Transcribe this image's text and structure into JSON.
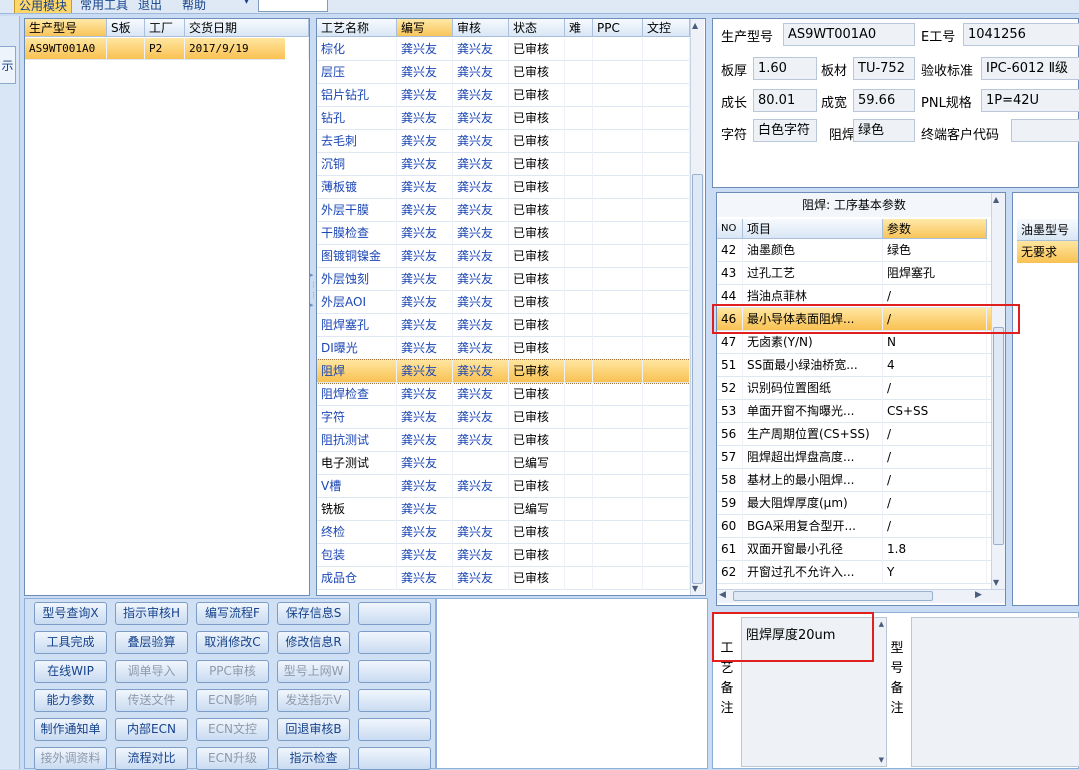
{
  "menu": {
    "items": [
      "公用模块",
      "常用工具",
      "退出",
      "帮助"
    ]
  },
  "left_tab": "示",
  "orders": {
    "headers": [
      "生产型号",
      "S板",
      "工厂",
      "交货日期"
    ],
    "rows": [
      [
        "AS9WT001A0",
        "",
        "P2",
        "2017/9/19"
      ]
    ]
  },
  "process": {
    "headers": [
      "工艺名称",
      "编写",
      "审核",
      "状态",
      "难",
      "PPC",
      "文控"
    ],
    "rows": [
      [
        "棕化",
        "龚兴友",
        "龚兴友",
        "已审核"
      ],
      [
        "层压",
        "龚兴友",
        "龚兴友",
        "已审核"
      ],
      [
        "铝片钻孔",
        "龚兴友",
        "龚兴友",
        "已审核"
      ],
      [
        "钻孔",
        "龚兴友",
        "龚兴友",
        "已审核"
      ],
      [
        "去毛刺",
        "龚兴友",
        "龚兴友",
        "已审核"
      ],
      [
        "沉铜",
        "龚兴友",
        "龚兴友",
        "已审核"
      ],
      [
        "薄板镀",
        "龚兴友",
        "龚兴友",
        "已审核"
      ],
      [
        "外层干膜",
        "龚兴友",
        "龚兴友",
        "已审核"
      ],
      [
        "干膜检查",
        "龚兴友",
        "龚兴友",
        "已审核"
      ],
      [
        "图镀铜镍金",
        "龚兴友",
        "龚兴友",
        "已审核"
      ],
      [
        "外层蚀刻",
        "龚兴友",
        "龚兴友",
        "已审核"
      ],
      [
        "外层AOI",
        "龚兴友",
        "龚兴友",
        "已审核"
      ],
      [
        "阻焊塞孔",
        "龚兴友",
        "龚兴友",
        "已审核"
      ],
      [
        "DI曝光",
        "龚兴友",
        "龚兴友",
        "已审核"
      ],
      [
        "阻焊",
        "龚兴友",
        "龚兴友",
        "已审核"
      ],
      [
        "阻焊检查",
        "龚兴友",
        "龚兴友",
        "已审核"
      ],
      [
        "字符",
        "龚兴友",
        "龚兴友",
        "已审核"
      ],
      [
        "阻抗测试",
        "龚兴友",
        "龚兴友",
        "已审核"
      ],
      [
        "电子测试",
        "龚兴友",
        "",
        "已编写"
      ],
      [
        "V槽",
        "龚兴友",
        "龚兴友",
        "已审核"
      ],
      [
        "铣板",
        "龚兴友",
        "",
        "已编写"
      ],
      [
        "终检",
        "龚兴友",
        "龚兴友",
        "已审核"
      ],
      [
        "包装",
        "龚兴友",
        "龚兴友",
        "已审核"
      ],
      [
        "成品仓",
        "龚兴友",
        "龚兴友",
        "已审核"
      ]
    ]
  },
  "info": {
    "model_label": "生产型号",
    "model": "AS9WT001A0",
    "eno_label": "E工号",
    "eno": "1041256",
    "thick_label": "板厚",
    "thick": "1.60",
    "mat_label": "板材",
    "mat": "TU-752",
    "std_label": "验收标准",
    "std": "IPC-6012 Ⅱ级",
    "len_label": "成长",
    "len": "80.01",
    "wid_label": "成宽",
    "wid": "59.66",
    "pnl_label": "PNL规格",
    "pnl": "1P=42U",
    "char_label": "字符",
    "char": "白色字符",
    "mask_label": "阻焊",
    "mask": "绿色",
    "cust_label": "终端客户代码",
    "cust": ""
  },
  "params": {
    "title": "阻焊: 工序基本参数",
    "headers": [
      "NO",
      "项目",
      "参数"
    ],
    "rows": [
      [
        "42",
        "油墨颜色",
        "绿色"
      ],
      [
        "43",
        "过孔工艺",
        "阻焊塞孔"
      ],
      [
        "44",
        "挡油点菲林",
        "/"
      ],
      [
        "46",
        "最小导体表面阻焊...",
        "/"
      ],
      [
        "47",
        "无卤素(Y/N)",
        "N"
      ],
      [
        "51",
        "SS面最小绿油桥宽...",
        "4"
      ],
      [
        "52",
        "识别码位置图纸",
        "/"
      ],
      [
        "53",
        "单面开窗不掏曝光...",
        "CS+SS"
      ],
      [
        "56",
        "生产周期位置(CS+SS)",
        "/"
      ],
      [
        "57",
        "阻焊超出焊盘高度...",
        "/"
      ],
      [
        "58",
        "基材上的最小阻焊...",
        "/"
      ],
      [
        "59",
        "最大阻焊厚度(μm)",
        "/"
      ],
      [
        "60",
        "BGA采用复合型开...",
        "/"
      ],
      [
        "61",
        "双面开窗最小孔径",
        "1.8"
      ],
      [
        "62",
        "开窗过孔不允许入...",
        "Y"
      ]
    ]
  },
  "ink": {
    "header": "油墨型号",
    "value": "无要求"
  },
  "buttons": [
    [
      "型号查询X",
      "指示审核H",
      "编写流程F",
      "保存信息S",
      ""
    ],
    [
      "工具完成",
      "叠层验算",
      "取消修改C",
      "修改信息R",
      ""
    ],
    [
      "在线WIP",
      "调单导入",
      "PPC审核",
      "型号上网W",
      ""
    ],
    [
      "能力参数",
      "传送文件",
      "ECN影响",
      "发送指示V",
      ""
    ],
    [
      "制作通知单",
      "内部ECN",
      "ECN文控",
      "回退审核B",
      ""
    ],
    [
      "接外调资料",
      "流程对比",
      "ECN升级",
      "指示检查",
      ""
    ]
  ],
  "notes": {
    "process_label": "工艺备注",
    "process_note": "阻焊厚度20um",
    "model_label": "型号备注"
  }
}
